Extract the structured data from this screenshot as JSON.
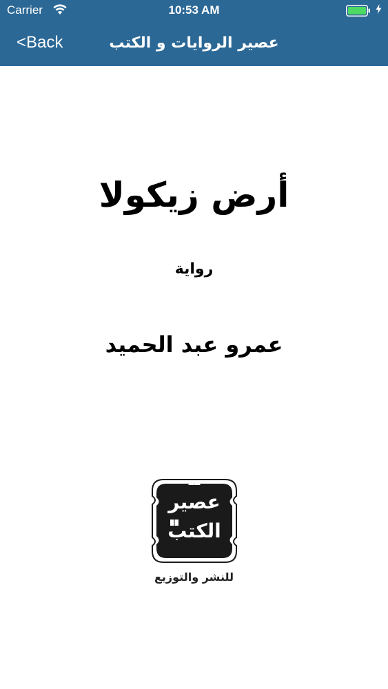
{
  "status_bar": {
    "carrier": "Carrier",
    "time": "10:53 AM",
    "icons": [
      "wifi-icon",
      "battery-icon",
      "charging-icon"
    ],
    "battery_color": "#4cd964"
  },
  "nav_bar": {
    "back_label": "<Back",
    "title": "عصير الروايات و الكتب",
    "background_color": "#2b6896"
  },
  "book": {
    "title": "أرض زيكولا",
    "genre": "رواية",
    "author": "عمرو عبد الحميد"
  },
  "publisher": {
    "logo_line1": "عصير",
    "logo_line2": "الكتب",
    "tagline": "للنشر والتوزيع"
  }
}
